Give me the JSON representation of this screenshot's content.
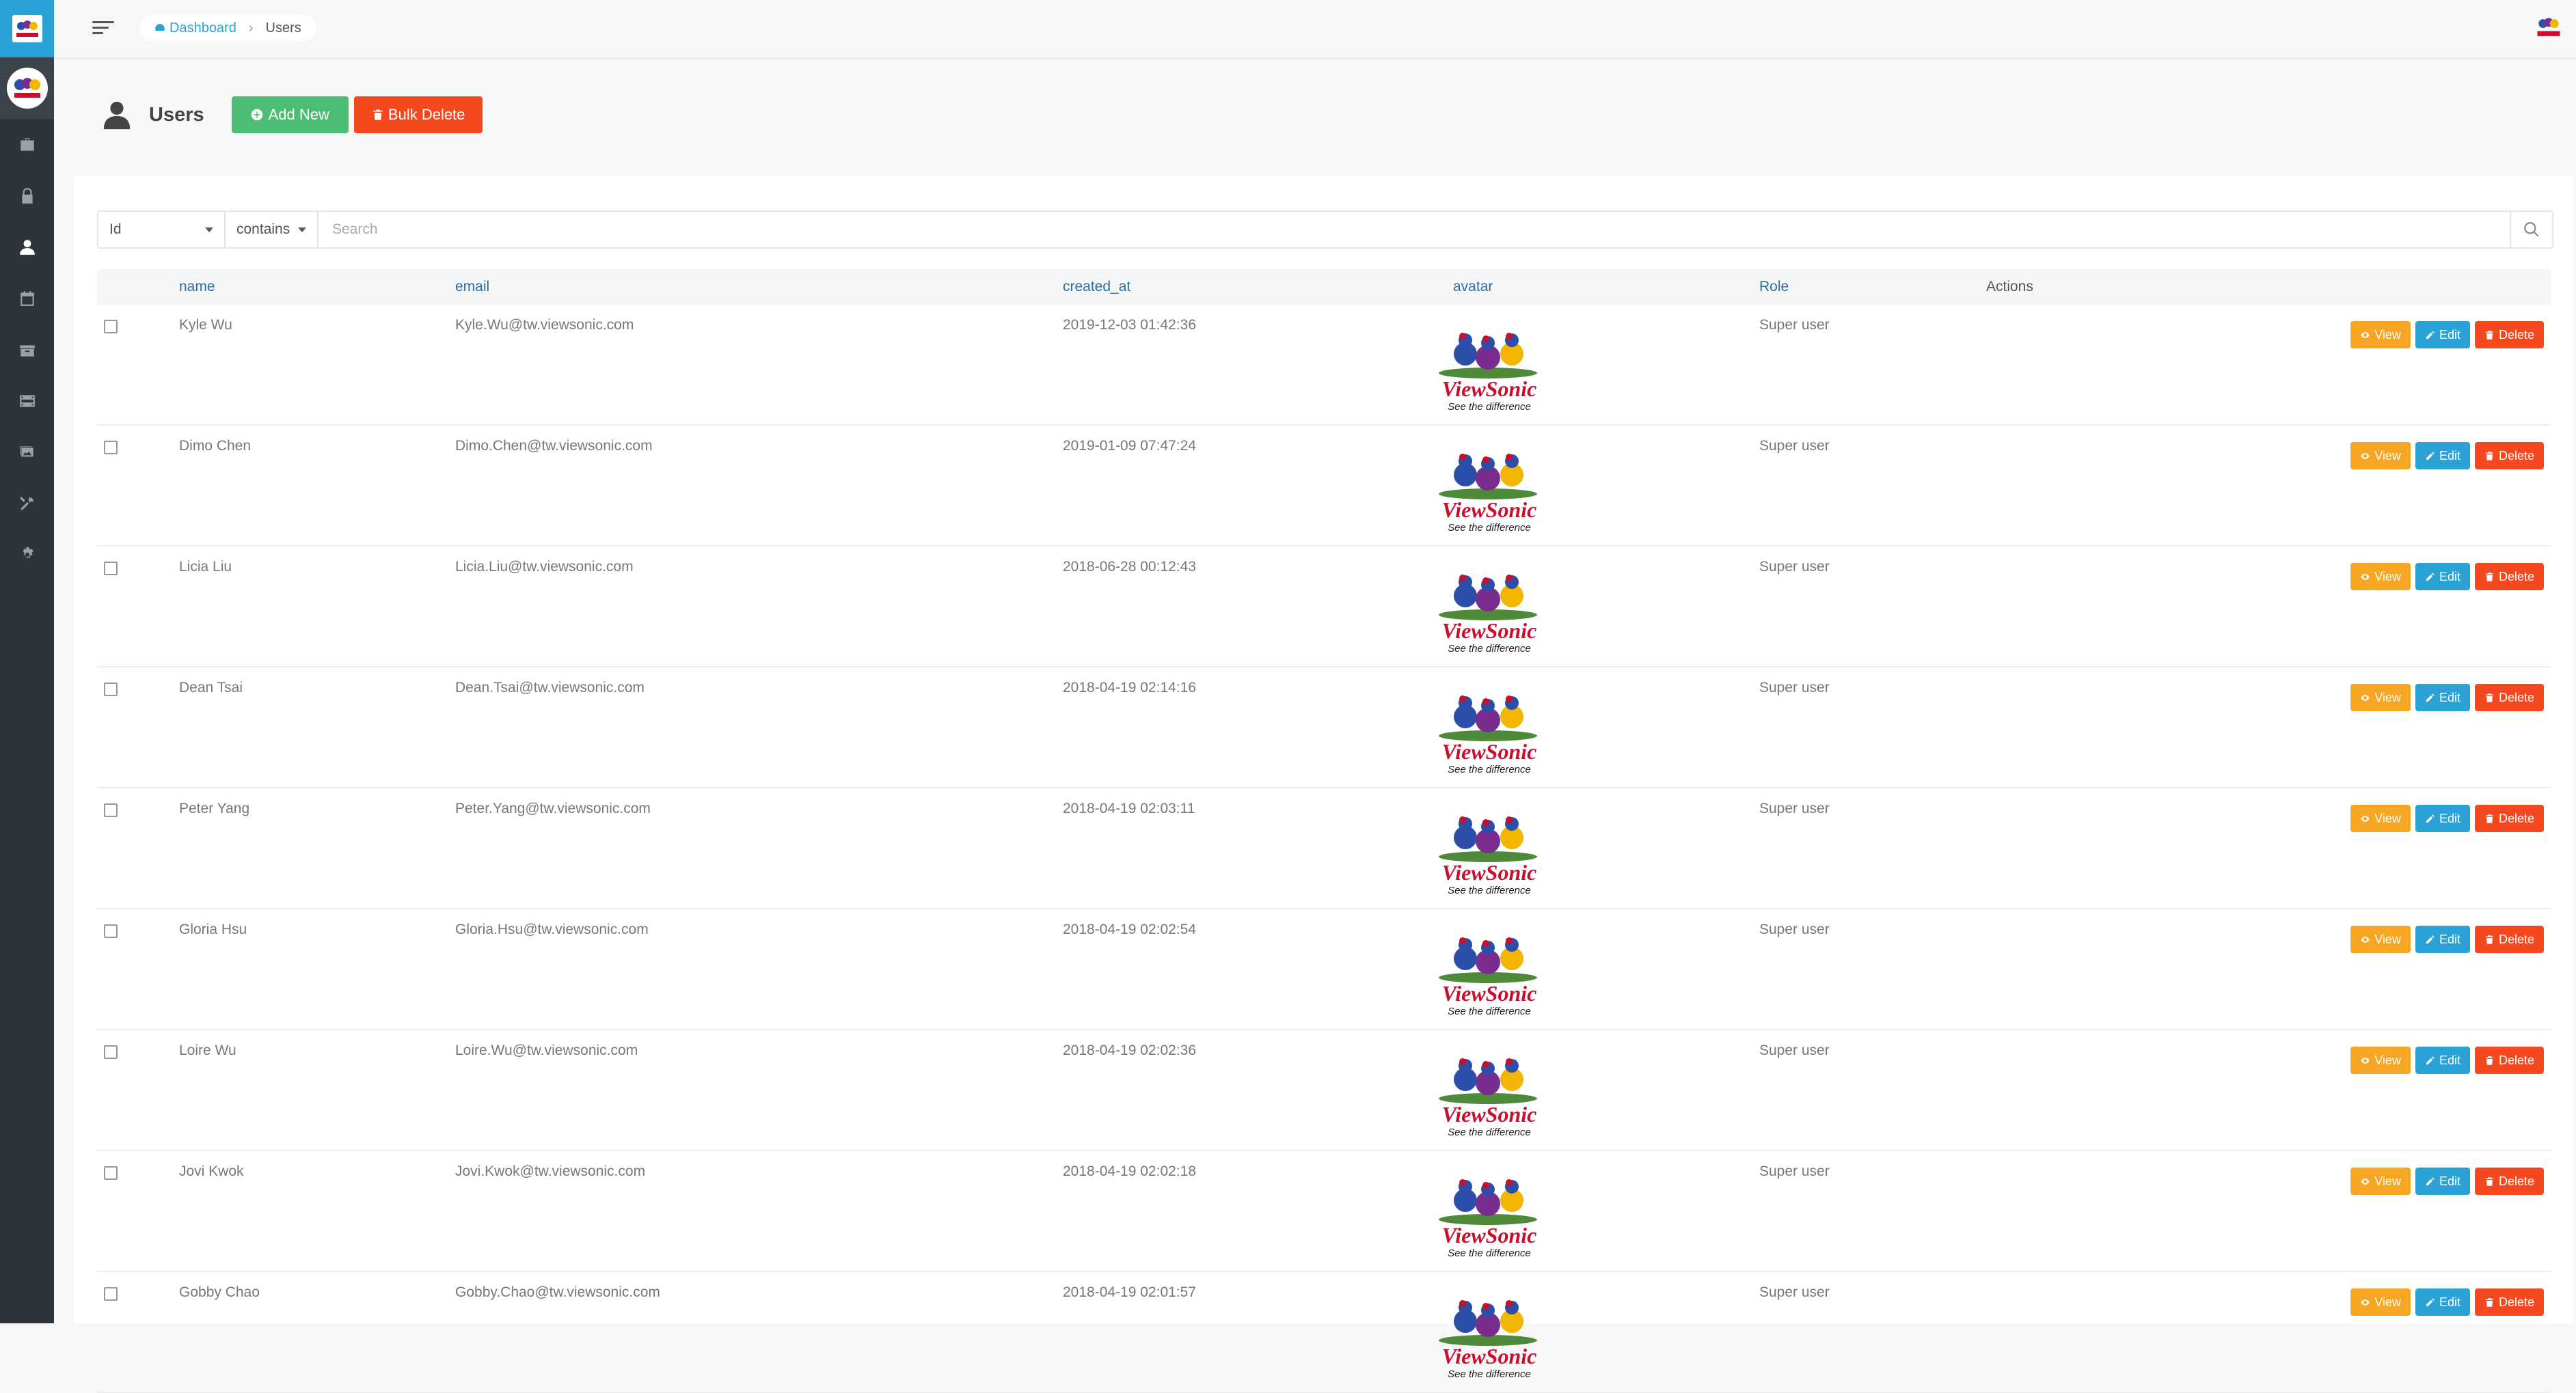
{
  "breadcrumb": {
    "home": "Dashboard",
    "current": "Users"
  },
  "page": {
    "title": "Users",
    "add_label": "Add New",
    "bulk_delete_label": "Bulk Delete"
  },
  "filter": {
    "field": "Id",
    "operator": "contains",
    "placeholder": "Search"
  },
  "table": {
    "headers": {
      "name": "name",
      "email": "email",
      "created_at": "created_at",
      "avatar": "avatar",
      "role": "Role",
      "actions": "Actions"
    },
    "action_labels": {
      "view": "View",
      "edit": "Edit",
      "delete": "Delete"
    },
    "rows": [
      {
        "name": "Kyle Wu",
        "email": "Kyle.Wu@tw.viewsonic.com",
        "created_at": "2019-12-03 01:42:36",
        "role": "Super user"
      },
      {
        "name": "Dimo Chen",
        "email": "Dimo.Chen@tw.viewsonic.com",
        "created_at": "2019-01-09 07:47:24",
        "role": "Super user"
      },
      {
        "name": "Licia Liu",
        "email": "Licia.Liu@tw.viewsonic.com",
        "created_at": "2018-06-28 00:12:43",
        "role": "Super user"
      },
      {
        "name": "Dean Tsai",
        "email": "Dean.Tsai@tw.viewsonic.com",
        "created_at": "2018-04-19 02:14:16",
        "role": "Super user"
      },
      {
        "name": "Peter Yang",
        "email": "Peter.Yang@tw.viewsonic.com",
        "created_at": "2018-04-19 02:03:11",
        "role": "Super user"
      },
      {
        "name": "Gloria Hsu",
        "email": "Gloria.Hsu@tw.viewsonic.com",
        "created_at": "2018-04-19 02:02:54",
        "role": "Super user"
      },
      {
        "name": "Loire Wu",
        "email": "Loire.Wu@tw.viewsonic.com",
        "created_at": "2018-04-19 02:02:36",
        "role": "Super user"
      },
      {
        "name": "Jovi Kwok",
        "email": "Jovi.Kwok@tw.viewsonic.com",
        "created_at": "2018-04-19 02:02:18",
        "role": "Super user"
      },
      {
        "name": "Gobby Chao",
        "email": "Gobby.Chao@tw.viewsonic.com",
        "created_at": "2018-04-19 02:01:57",
        "role": "Super user"
      }
    ]
  },
  "avatar_logo": {
    "brand": "ViewSonic",
    "tagline": "See the difference"
  },
  "colors": {
    "sidebar": "#2d353c",
    "brand_blue": "#2aa2d6",
    "success": "#4dbd74",
    "danger": "#f5481e",
    "warning": "#f6a623"
  }
}
